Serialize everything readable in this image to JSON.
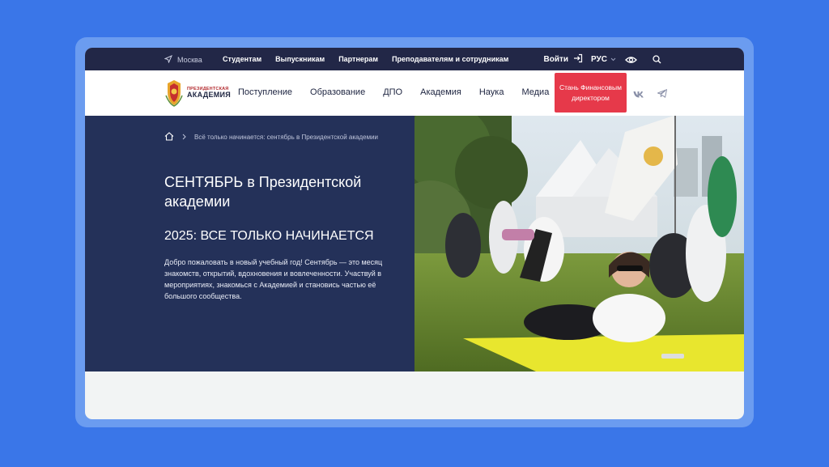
{
  "topbar": {
    "city": "Москва",
    "links": [
      "Студентам",
      "Выпускникам",
      "Партнерам",
      "Преподавателям и сотрудникам"
    ],
    "login": "Войти",
    "language": "РУС"
  },
  "logo": {
    "line1": "ПРЕЗИДЕНТСКАЯ",
    "line2": "АКАДЕМИЯ"
  },
  "nav": {
    "items": [
      "Поступление",
      "Образование",
      "ДПО",
      "Академия",
      "Наука",
      "Медиа"
    ],
    "cta": "Стань Финансовым директором"
  },
  "breadcrumb": {
    "current": "Всё только начинается: сентябрь в Президентской академии"
  },
  "hero": {
    "title": "СЕНТЯБРЬ в Президентской академии",
    "subtitle": "2025: ВСЕ ТОЛЬКО НАЧИНАЕТСЯ",
    "text": "Добро пожаловать в новый учебный год! Сентябрь — это месяц знакомств, открытий, вдохновения и вовлеченности. Участвуй в мероприятиях, знакомься с Академией и становись частью её большого сообщества."
  },
  "icons": {
    "location": "location-arrow-icon",
    "login": "login-icon",
    "language_chevron": "chevron-down-icon",
    "accessibility": "eye-icon",
    "search": "search-icon",
    "vk": "vk-icon",
    "telegram": "telegram-icon",
    "home": "home-icon",
    "breadcrumb_separator": "chevron-right-icon"
  },
  "colors": {
    "page_background": "#3a76e8",
    "topbar": "#222747",
    "hero_panel": "#243159",
    "cta": "#e6394a"
  }
}
